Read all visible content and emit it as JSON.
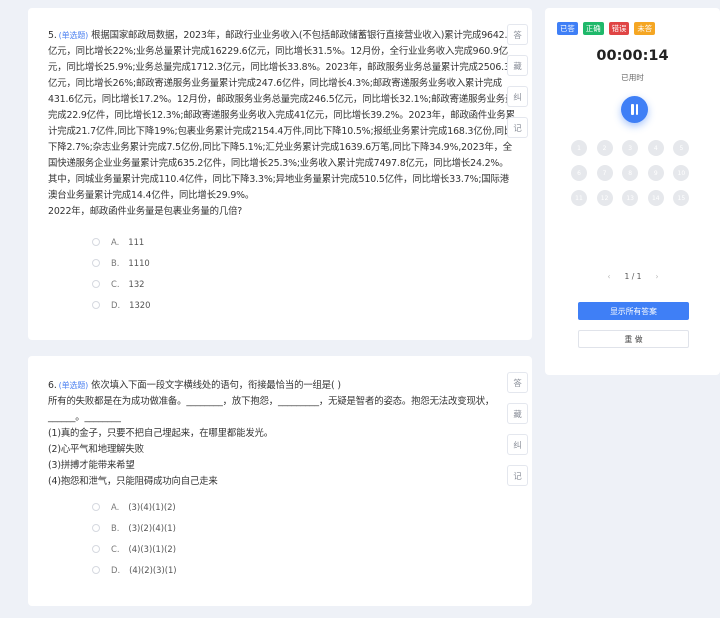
{
  "q5": {
    "num": "5.",
    "type": "(单选题)",
    "stem": "根据国家邮政局数据，2023年，邮政行业业务收入(不包括邮政储蓄银行直接营业收入)累计完成9642.5亿元，同比增长22%;业务总量累计完成16229.6亿元，同比增长31.5%。12月份，全行业业务收入完成960.9亿元，同比增长25.9%;业务总量完成1712.3亿元，同比增长33.8%。2023年，邮政服务业务总量累计完成2506.3亿元，同比增长26%;邮政寄递服务业务量累计完成247.6亿件，同比增长4.3%;邮政寄递服务业务收入累计完成431.6亿元，同比增长17.2%。12月份，邮政服务业务总量完成246.5亿元，同比增长32.1%;邮政寄递服务业务量完成22.9亿件，同比增长12.3%;邮政寄递服务业务收入完成41亿元，同比增长39.2%。2023年，邮政函件业务累计完成21.7亿件,同比下降19%;包裹业务累计完成2154.4万件,同比下降10.5%;报纸业务累计完成168.3亿份,同比下降2.7%;杂志业务累计完成7.5亿份,同比下降5.1%;汇兑业务累计完成1639.6万笔,同比下降34.9%,2023年，全国快递服务企业业务量累计完成635.2亿件，同比增长25.3%;业务收入累计完成7497.8亿元，同比增长24.2%。其中，同城业务量累计完成110.4亿件，同比下降3.3%;异地业务量累计完成510.5亿件，同比增长33.7%;国际港澳台业务量累计完成14.4亿件，同比增长29.9%。",
    "question": "2022年，邮政函件业务量是包裹业务量的几倍?",
    "options": [
      {
        "letter": "A.",
        "text": "111"
      },
      {
        "letter": "B.",
        "text": "1110"
      },
      {
        "letter": "C.",
        "text": "132"
      },
      {
        "letter": "D.",
        "text": "1320"
      }
    ]
  },
  "q6": {
    "num": "6.",
    "type": "(单选题)",
    "title": "依次填入下面一段文字横线处的语句，衔接最恰当的一组是(    )",
    "passage": "所有的失败都是在为成功做准备。________，放下抱怨，_________，无疑是智者的姿态。抱怨无法改变现状，______。________",
    "items": [
      "(1)真的金子，只要不把自己埋起来，在哪里都能发光。",
      "(2)心平气和地理解失败",
      "(3)拼搏才能带来希望",
      "(4)抱怨和泄气，只能阻碍成功向自己走来"
    ],
    "options": [
      {
        "letter": "A.",
        "text": "(3)(4)(1)(2)"
      },
      {
        "letter": "B.",
        "text": "(3)(2)(4)(1)"
      },
      {
        "letter": "C.",
        "text": "(4)(3)(1)(2)"
      },
      {
        "letter": "D.",
        "text": "(4)(2)(3)(1)"
      }
    ]
  },
  "tools": [
    "答",
    "藏",
    "纠",
    "记"
  ],
  "panel": {
    "legend": [
      {
        "label": "已答",
        "color": "#3f7ff6"
      },
      {
        "label": "正确",
        "color": "#1fb86a"
      },
      {
        "label": "错误",
        "color": "#e04545"
      },
      {
        "label": "未答",
        "color": "#f5a623"
      }
    ],
    "timer": "00:00:14",
    "used_label": "已用时",
    "numbers": [
      "1",
      "2",
      "3",
      "4",
      "5",
      "6",
      "7",
      "8",
      "9",
      "10",
      "11",
      "12",
      "13",
      "14",
      "15"
    ],
    "page_indicator": "1 / 1",
    "prev": "‹",
    "next": "›",
    "show_answers": "显示所有答案",
    "redo": "重 做"
  }
}
